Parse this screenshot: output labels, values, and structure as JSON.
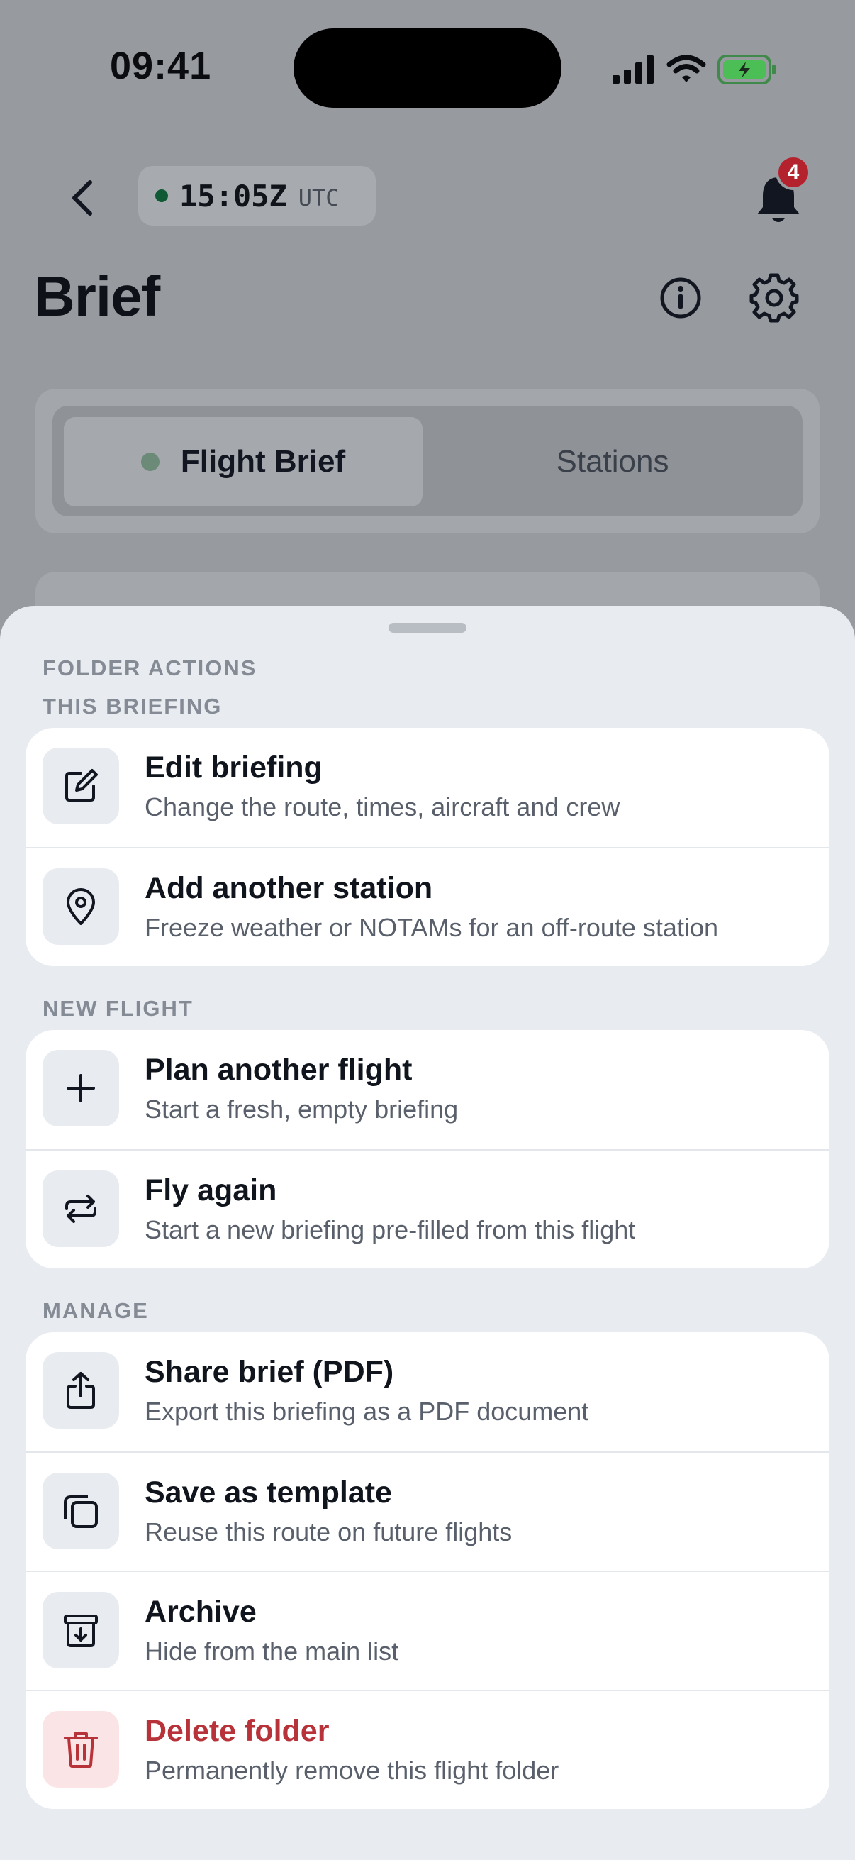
{
  "status_bar": {
    "time": "09:41"
  },
  "header": {
    "utc_time": "15:05Z",
    "utc_label": "UTC",
    "notification_count": "4",
    "title": "Brief"
  },
  "tabs": [
    {
      "label": "Flight Brief",
      "active": true
    },
    {
      "label": "Stations",
      "active": false
    }
  ],
  "sheet": {
    "title": "FOLDER ACTIONS",
    "sections": [
      {
        "header": "THIS BRIEFING",
        "items": [
          {
            "title": "Edit briefing",
            "subtitle": "Change the route, times, aircraft and crew",
            "icon": "edit-icon"
          },
          {
            "title": "Add another station",
            "subtitle": "Freeze weather or NOTAMs for an off-route station",
            "icon": "map-pin-icon"
          }
        ]
      },
      {
        "header": "NEW FLIGHT",
        "items": [
          {
            "title": "Plan another flight",
            "subtitle": "Start a fresh, empty briefing",
            "icon": "plus-icon"
          },
          {
            "title": "Fly again",
            "subtitle": "Start a new briefing pre-filled from this flight",
            "icon": "repeat-icon"
          }
        ]
      },
      {
        "header": "MANAGE",
        "items": [
          {
            "title": "Share brief (PDF)",
            "subtitle": "Export this briefing as a PDF document",
            "icon": "share-icon"
          },
          {
            "title": "Save as template",
            "subtitle": "Reuse this route on future flights",
            "icon": "copy-icon"
          },
          {
            "title": "Archive",
            "subtitle": "Hide from the main list",
            "icon": "archive-icon"
          },
          {
            "title": "Delete folder",
            "subtitle": "Permanently remove this flight folder",
            "icon": "trash-icon",
            "destructive": true
          }
        ]
      }
    ]
  },
  "colors": {
    "accent_green": "#0f5a35",
    "badge_red": "#b4232d",
    "destructive": "#b8323a",
    "sheet_bg": "#e8ebf0"
  }
}
